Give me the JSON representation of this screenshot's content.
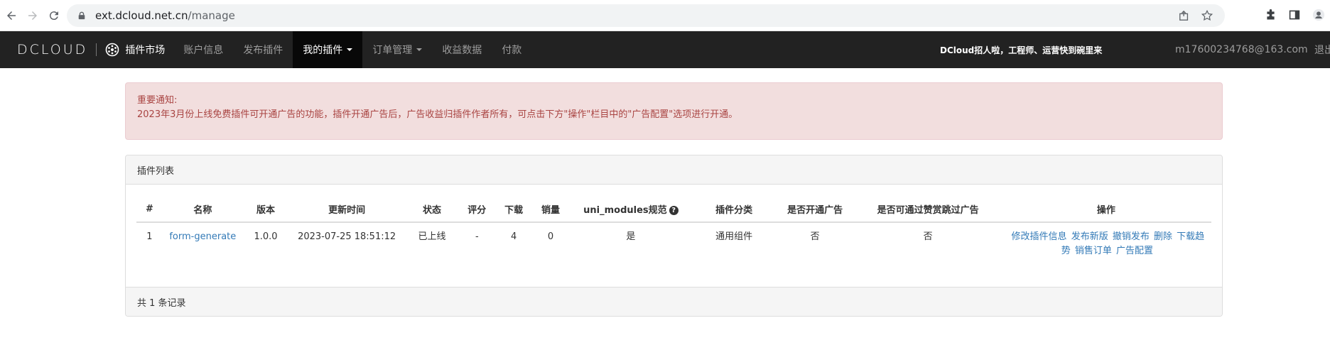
{
  "browser": {
    "url_host": "ext.dcloud.net.cn",
    "url_path": "/manage"
  },
  "navbar": {
    "logo": "DCLOUD",
    "market_label": "插件市场",
    "items": [
      {
        "label": "账户信息",
        "dropdown": false,
        "active": false
      },
      {
        "label": "发布插件",
        "dropdown": false,
        "active": false
      },
      {
        "label": "我的插件",
        "dropdown": true,
        "active": true
      },
      {
        "label": "订单管理",
        "dropdown": true,
        "active": false
      },
      {
        "label": "收益数据",
        "dropdown": false,
        "active": false
      },
      {
        "label": "付款",
        "dropdown": false,
        "active": false
      }
    ],
    "promo": "DCloud招人啦，工程师、运营快到碗里来",
    "email": "m17600234768@163.com",
    "logout": "退出"
  },
  "alert": {
    "title": "重要通知:",
    "message": "2023年3月份上线免费插件可开通广告的功能，插件开通广告后，广告收益归插件作者所有，可点击下方\"操作\"栏目中的\"广告配置\"选项进行开通。"
  },
  "panel": {
    "heading": "插件列表",
    "footer": "共 1 条记录",
    "columns": [
      "#",
      "名称",
      "版本",
      "更新时间",
      "状态",
      "评分",
      "下载",
      "销量",
      "uni_modules规范",
      "插件分类",
      "是否开通广告",
      "是否可通过赞赏跳过广告",
      "操作"
    ],
    "rows": [
      {
        "index": "1",
        "name": "form-generate",
        "version": "1.0.0",
        "updated": "2023-07-25 18:51:12",
        "status": "已上线",
        "rating": "-",
        "downloads": "4",
        "sales": "0",
        "uni_modules": "是",
        "category": "通用组件",
        "ads_enabled": "否",
        "skip_ads": "否",
        "actions": {
          "edit": "修改插件信息",
          "publish": "发布新版",
          "unpublish": "撤销发布",
          "delete": "删除",
          "trend": "下载趋势",
          "orders": "销售订单",
          "ad_config": "广告配置"
        }
      }
    ]
  },
  "colors": {
    "navbar_bg": "#222222",
    "navbar_active": "#080808",
    "alert_bg": "#f2dede",
    "alert_text": "#a94442",
    "link": "#337ab7"
  }
}
